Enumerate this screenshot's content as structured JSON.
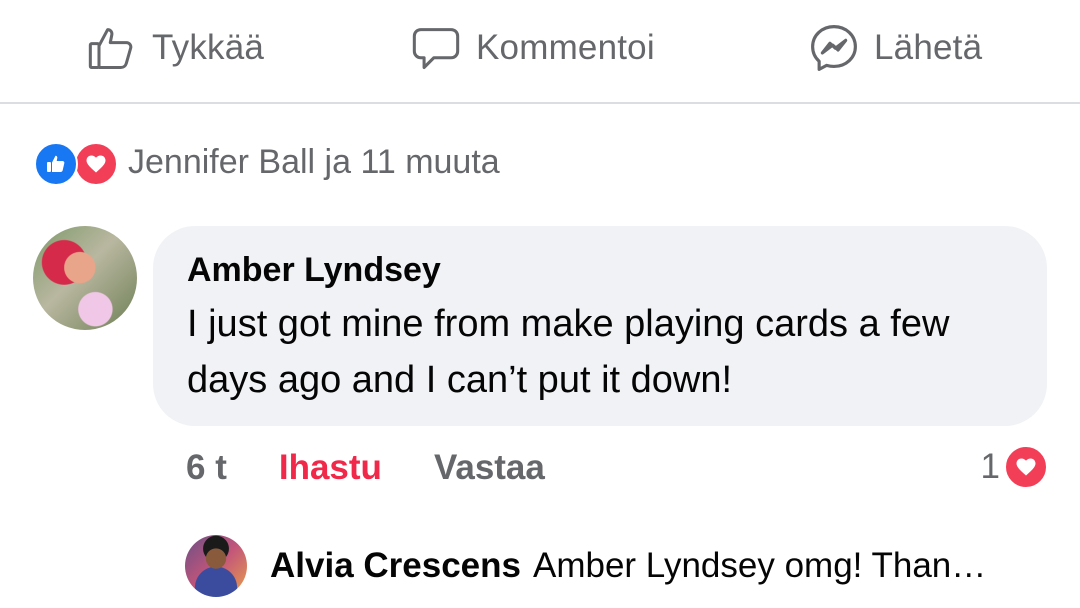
{
  "actions": {
    "like_label": "Tykkää",
    "like_icon": "thumbs-up-outline-icon",
    "comment_label": "Kommentoi",
    "comment_icon": "speech-bubble-icon",
    "send_label": "Lähetä",
    "send_icon": "messenger-icon"
  },
  "reactions": {
    "icons": [
      "like-reaction-icon",
      "love-reaction-icon"
    ],
    "summary": "Jennifer Ball ja 11 muuta"
  },
  "comment": {
    "author": "Amber Lyndsey",
    "text": "I just got mine from make playing cards a few days ago and I can’t put it down!",
    "time": "6 t",
    "love_label": "Ihastu",
    "reply_label": "Vastaa",
    "reaction_count": "1",
    "reaction_icon": "love-reaction-icon"
  },
  "reply": {
    "author": "Alvia Crescens",
    "text": "Amber Lyndsey omg! Than…"
  },
  "colors": {
    "secondary_text": "#65676b",
    "love_red": "#f02849",
    "like_blue": "#1877f2",
    "bubble_bg": "#f0f2f5",
    "divider": "#dadde1"
  }
}
